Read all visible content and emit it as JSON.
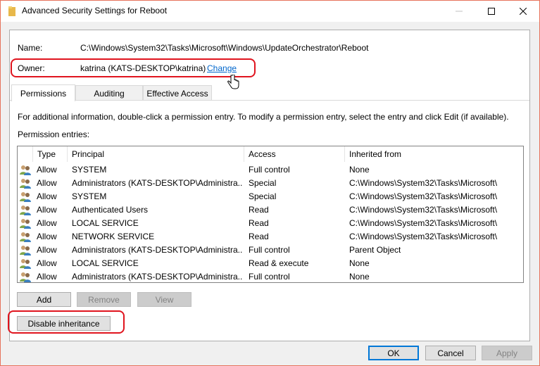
{
  "window": {
    "title": "Advanced Security Settings for Reboot",
    "icon": "folder-icon",
    "controls": [
      "minimize",
      "maximize",
      "close"
    ]
  },
  "object": {
    "name_label": "Name:",
    "name_value": "C:\\Windows\\System32\\Tasks\\Microsoft\\Windows\\UpdateOrchestrator\\Reboot",
    "owner_label": "Owner:",
    "owner_value": "katrina (KATS-DESKTOP\\katrina)",
    "change_link": "Change"
  },
  "tabs": [
    {
      "label": "Permissions",
      "active": true
    },
    {
      "label": "Auditing",
      "active": false
    },
    {
      "label": "Effective Access",
      "active": false
    }
  ],
  "permissions": {
    "info_text": "For additional information, double-click a permission entry. To modify a permission entry, select the entry and click Edit (if available).",
    "entries_label": "Permission entries:",
    "columns": [
      "Type",
      "Principal",
      "Access",
      "Inherited from"
    ],
    "rows": [
      {
        "type": "Allow",
        "principal": "SYSTEM",
        "access": "Full control",
        "inherited": "None"
      },
      {
        "type": "Allow",
        "principal": "Administrators (KATS-DESKTOP\\Administra...",
        "access": "Special",
        "inherited": "C:\\Windows\\System32\\Tasks\\Microsoft\\"
      },
      {
        "type": "Allow",
        "principal": "SYSTEM",
        "access": "Special",
        "inherited": "C:\\Windows\\System32\\Tasks\\Microsoft\\"
      },
      {
        "type": "Allow",
        "principal": "Authenticated Users",
        "access": "Read",
        "inherited": "C:\\Windows\\System32\\Tasks\\Microsoft\\"
      },
      {
        "type": "Allow",
        "principal": "LOCAL SERVICE",
        "access": "Read",
        "inherited": "C:\\Windows\\System32\\Tasks\\Microsoft\\"
      },
      {
        "type": "Allow",
        "principal": "NETWORK SERVICE",
        "access": "Read",
        "inherited": "C:\\Windows\\System32\\Tasks\\Microsoft\\"
      },
      {
        "type": "Allow",
        "principal": "Administrators (KATS-DESKTOP\\Administra...",
        "access": "Full control",
        "inherited": "Parent Object"
      },
      {
        "type": "Allow",
        "principal": "LOCAL SERVICE",
        "access": "Read & execute",
        "inherited": "None"
      },
      {
        "type": "Allow",
        "principal": "Administrators (KATS-DESKTOP\\Administra...",
        "access": "Full control",
        "inherited": "None"
      }
    ],
    "buttons": {
      "add": "Add",
      "remove": "Remove",
      "view": "View",
      "disable_inheritance": "Disable inheritance"
    }
  },
  "footer": {
    "ok": "OK",
    "cancel": "Cancel",
    "apply": "Apply"
  },
  "colors": {
    "link": "#0066cc",
    "highlight": "#e0141e",
    "focus": "#0078d7",
    "window_border": "#e6735c"
  }
}
